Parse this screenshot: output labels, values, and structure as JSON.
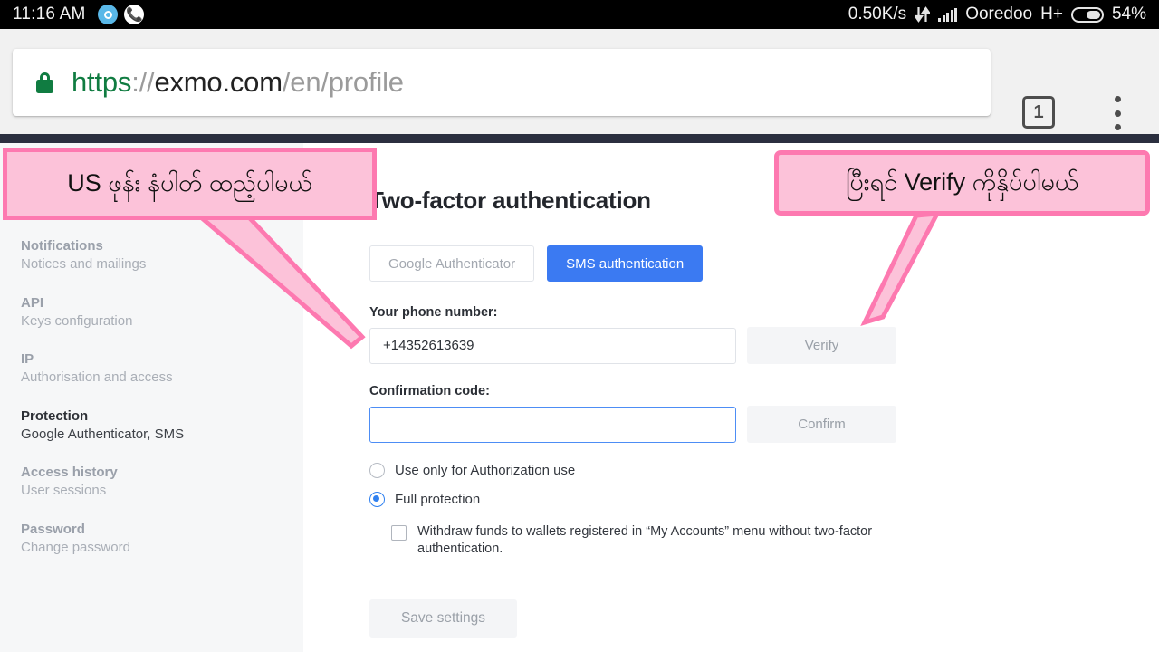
{
  "status_bar": {
    "clock": "11:16 AM",
    "left_icons": [
      "chat-bubble-icon",
      "phone-call-icon"
    ],
    "data_rate": "0.50K/s",
    "transfer_icon": "data-transfer-arrows-icon",
    "signal_icon": "cellular-signal-icon",
    "carrier": "Ooredoo",
    "network_type": "H+",
    "battery_icon": "battery-icon",
    "battery_percent": "54%"
  },
  "browser": {
    "lock_icon": "secure-lock-icon",
    "url": {
      "scheme": "https",
      "separator": "://",
      "host": "exmo.com",
      "path": "/en/profile"
    },
    "tab_count": "1",
    "menu_icon": "overflow-menu-icon"
  },
  "sidebar": {
    "items": [
      {
        "title": "Notifications",
        "subtitle": "Notices and mailings",
        "active": false
      },
      {
        "title": "API",
        "subtitle": "Keys configuration",
        "active": false
      },
      {
        "title": "IP",
        "subtitle": "Authorisation and access",
        "active": false
      },
      {
        "title": "Protection",
        "subtitle": "Google Authenticator, SMS",
        "active": true
      },
      {
        "title": "Access history",
        "subtitle": "User sessions",
        "active": false
      },
      {
        "title": "Password",
        "subtitle": "Change password",
        "active": false
      }
    ]
  },
  "main": {
    "heading": "Two-factor authentication",
    "tabs": [
      {
        "label": "Google Authenticator",
        "active": false
      },
      {
        "label": "SMS authentication",
        "active": true
      }
    ],
    "phone": {
      "label": "Your phone number:",
      "value": "+14352613639",
      "placeholder": "",
      "button": "Verify"
    },
    "code": {
      "label": "Confirmation code:",
      "value": "",
      "placeholder": "",
      "button": "Confirm"
    },
    "options": [
      {
        "label": "Use only for Authorization use",
        "checked": false
      },
      {
        "label": "Full protection",
        "checked": true
      }
    ],
    "withdraw_checkbox": {
      "label": "Withdraw funds to wallets registered in “My Accounts” menu without two-factor authentication.",
      "checked": false
    },
    "save_button": "Save settings"
  },
  "annotations": {
    "left": "US ဖုန်း နံပါတ် ထည့်ပါမယ်",
    "right": "ပြီးရင် Verify ကိုနှိပ်ပါမယ်"
  },
  "colors": {
    "accent_blue": "#3b7af2",
    "radio_blue": "#2f80f0",
    "annotation_fill": "#fcc2d9",
    "annotation_border": "#fd79b0",
    "site_band": "#2b2f3f",
    "lock_green": "#107c41",
    "sidebar_bg": "#f6f7f8"
  }
}
